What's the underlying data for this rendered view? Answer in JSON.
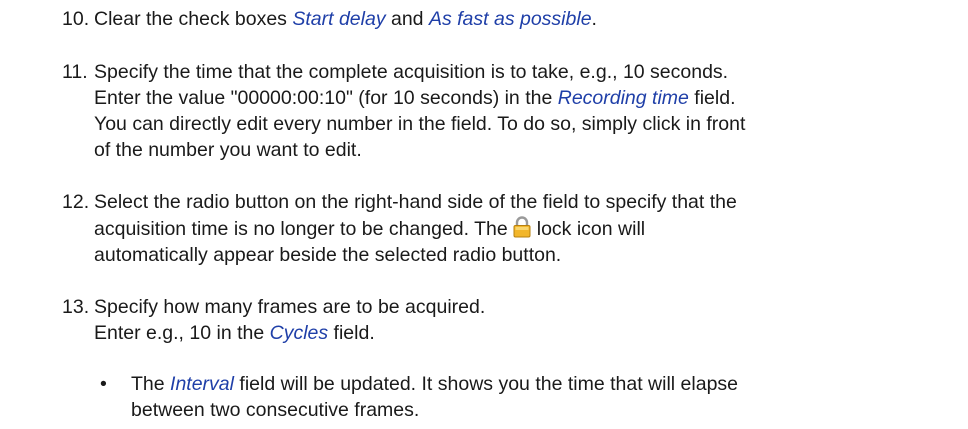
{
  "steps": [
    {
      "number": "10.",
      "line1": {
        "a": "Clear the check boxes ",
        "em1": "Start delay",
        "b": " and ",
        "em2": "As fast as possible",
        "c": "."
      }
    },
    {
      "number": "11.",
      "line1": "Specify the time that the complete acquisition is to take, e.g., 10 seconds.",
      "line2": {
        "a": "Enter the value \"00000:00:10\" (for 10 seconds) in the ",
        "em": "Recording time",
        "b": " field."
      },
      "line3": "You can directly edit every number in the field. To do so, simply click in front",
      "line4": "of the number you want to edit."
    },
    {
      "number": "12.",
      "line1": "Select the radio button on the right-hand side of the field to specify that the",
      "line2": {
        "a": "acquisition time is no longer to be changed. The",
        "icon": "lock-icon",
        "b": "lock icon will"
      },
      "line3": "automatically appear beside the selected radio button."
    },
    {
      "number": "13.",
      "line1": "Specify how many frames are to be acquired.",
      "line2": {
        "a": "Enter e.g., 10 in the ",
        "em": "Cycles",
        "b": " field."
      },
      "bullet": {
        "symbol": "•",
        "line1": {
          "a": "The ",
          "em": "Interval",
          "b": " field will be updated. It shows you the time that will elapse"
        },
        "line2": "between two consecutive frames."
      }
    }
  ],
  "colors": {
    "text": "#1a1a1a",
    "emphasis": "#1f3fa8",
    "lock_body": "#f2b62a",
    "lock_shackle": "#9a9a9a"
  }
}
